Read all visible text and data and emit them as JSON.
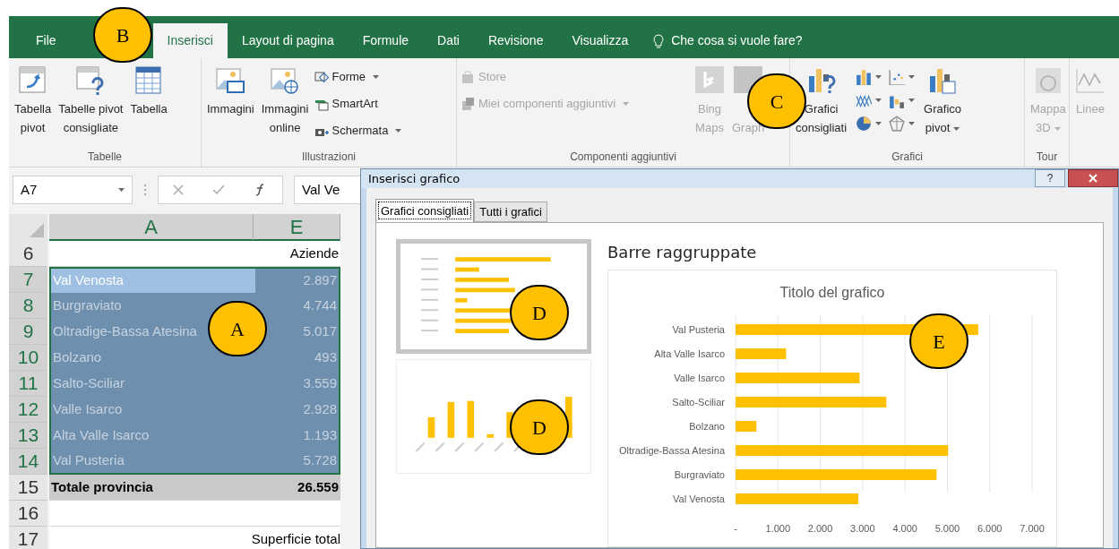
{
  "ribbon_tabs": [
    {
      "label": "File",
      "selected": false
    },
    {
      "label": "Inserisci",
      "selected": true
    },
    {
      "label": "Layout di pagina",
      "selected": false
    },
    {
      "label": "Formule",
      "selected": false
    },
    {
      "label": "Dati",
      "selected": false
    },
    {
      "label": "Revisione",
      "selected": false
    },
    {
      "label": "Visualizza",
      "selected": false
    }
  ],
  "tell_me": {
    "placeholder": "Che cosa si vuole fare?"
  },
  "ribbon_groups": [
    {
      "label": "Tabelle",
      "items": [
        {
          "kind": "large",
          "label": "Tabella\npivot",
          "disabled": false,
          "dropdown": false
        },
        {
          "kind": "large",
          "label": "Tabelle pivot\nconsigliate",
          "disabled": false,
          "dropdown": false
        },
        {
          "kind": "large",
          "label": "Tabella",
          "disabled": false,
          "dropdown": false
        }
      ]
    },
    {
      "label": "Illustrazioni",
      "items": [
        {
          "kind": "large",
          "label": "Immagini",
          "disabled": false,
          "dropdown": false
        },
        {
          "kind": "large",
          "label": "Immagini\nonline",
          "disabled": false,
          "dropdown": false
        },
        {
          "kind": "stack",
          "items": [
            {
              "label": "Forme",
              "disabled": false,
              "dropdown": true
            },
            {
              "label": "SmartArt",
              "disabled": false,
              "dropdown": false
            },
            {
              "label": "Schermata",
              "disabled": false,
              "dropdown": true
            }
          ]
        }
      ]
    },
    {
      "label": "Componenti aggiuntivi",
      "items": [
        {
          "kind": "stack",
          "items": [
            {
              "label": "Store",
              "disabled": true,
              "dropdown": false
            },
            {
              "label": "Miei componenti aggiuntivi",
              "disabled": true,
              "dropdown": true
            }
          ]
        },
        {
          "kind": "large",
          "label": "Bing\nMaps",
          "disabled": true,
          "dropdown": false
        },
        {
          "kind": "large",
          "label": "\nGraph",
          "disabled": true,
          "dropdown": false
        }
      ]
    },
    {
      "label": "Grafici",
      "items": [
        {
          "kind": "large",
          "label": "Grafici\nconsigliati",
          "disabled": false,
          "dropdown": false
        },
        {
          "kind": "chart-grid"
        },
        {
          "kind": "large",
          "label": "Grafico\npivot",
          "disabled": false,
          "dropdown": true
        }
      ]
    },
    {
      "label": "Tour",
      "items": [
        {
          "kind": "large",
          "label": "Mappa\n3D",
          "disabled": true,
          "dropdown": true
        }
      ]
    },
    {
      "items": [
        {
          "kind": "large",
          "label": "Linee",
          "disabled": true,
          "dropdown": false
        }
      ]
    }
  ],
  "formula_bar": {
    "name_box": "A7",
    "value": "Val Ve"
  },
  "sheet": {
    "columns": [
      "A",
      "E"
    ],
    "rows": [
      {
        "number": "6",
        "a": "",
        "e": "Aziende",
        "selected": false,
        "active": false,
        "bold": false
      },
      {
        "number": "7",
        "a": "Val Venosta",
        "e": "2.897",
        "selected": true,
        "active": true,
        "bold": false
      },
      {
        "number": "8",
        "a": "Burgraviato",
        "e": "4.744",
        "selected": true,
        "active": false,
        "bold": false
      },
      {
        "number": "9",
        "a": "Oltradige-Bassa Atesina",
        "e": "5.017",
        "selected": true,
        "active": false,
        "bold": false
      },
      {
        "number": "10",
        "a": "Bolzano",
        "e": "493",
        "selected": true,
        "active": false,
        "bold": false
      },
      {
        "number": "11",
        "a": "Salto-Sciliar",
        "e": "3.559",
        "selected": true,
        "active": false,
        "bold": false
      },
      {
        "number": "12",
        "a": "Valle Isarco",
        "e": "2.928",
        "selected": true,
        "active": false,
        "bold": false
      },
      {
        "number": "13",
        "a": "Alta Valle Isarco",
        "e": "1.193",
        "selected": true,
        "active": false,
        "bold": false
      },
      {
        "number": "14",
        "a": "Val Pusteria",
        "e": "5.728",
        "selected": true,
        "active": false,
        "bold": false
      },
      {
        "number": "15",
        "a": "Totale provincia",
        "e": "26.559",
        "selected": false,
        "active": false,
        "bold": true
      },
      {
        "number": "16",
        "a": "",
        "e": "",
        "selected": false,
        "active": false,
        "bold": false
      },
      {
        "number": "17",
        "a": "",
        "e": "Superficie total",
        "selected": false,
        "active": false,
        "bold": false
      }
    ]
  },
  "dialog": {
    "title": "Inserisci grafico",
    "help": "?",
    "tabs": [
      {
        "label": "Grafici consigliati",
        "selected": true
      },
      {
        "label": "Tutti i grafici",
        "selected": false
      }
    ],
    "thumbnails": [
      {
        "kind": "bar",
        "selected": true
      },
      {
        "kind": "column",
        "selected": false
      }
    ],
    "preview_title": "Barre raggruppate",
    "chart": {
      "chart_data": {
        "type": "bar",
        "orientation": "horizontal",
        "title": "Titolo del grafico",
        "grid": true,
        "categories": [
          "Val Pusteria",
          "Alta Valle Isarco",
          "Valle Isarco",
          "Salto-Sciliar",
          "Bolzano",
          "Oltradige-Bassa Atesina",
          "Burgraviato",
          "Val Venosta"
        ],
        "series": [
          {
            "color": "#ffc000",
            "values": [
              5728,
              1193,
              2928,
              3559,
              493,
              5017,
              4744,
              2897
            ]
          }
        ],
        "xlim": [
          0,
          7000
        ],
        "xticks": [
          {
            "value": 0,
            "label": "-"
          },
          {
            "value": 1000,
            "label": "1.000"
          },
          {
            "value": 2000,
            "label": "2.000"
          },
          {
            "value": 3000,
            "label": "3.000"
          },
          {
            "value": 4000,
            "label": "4.000"
          },
          {
            "value": 5000,
            "label": "5.000"
          },
          {
            "value": 6000,
            "label": "6.000"
          },
          {
            "value": 7000,
            "label": "7.000"
          }
        ]
      }
    }
  },
  "callouts": [
    {
      "label": "B"
    },
    {
      "label": "C"
    },
    {
      "label": "A"
    },
    {
      "label": "D"
    },
    {
      "label": "D"
    },
    {
      "label": "E"
    }
  ]
}
